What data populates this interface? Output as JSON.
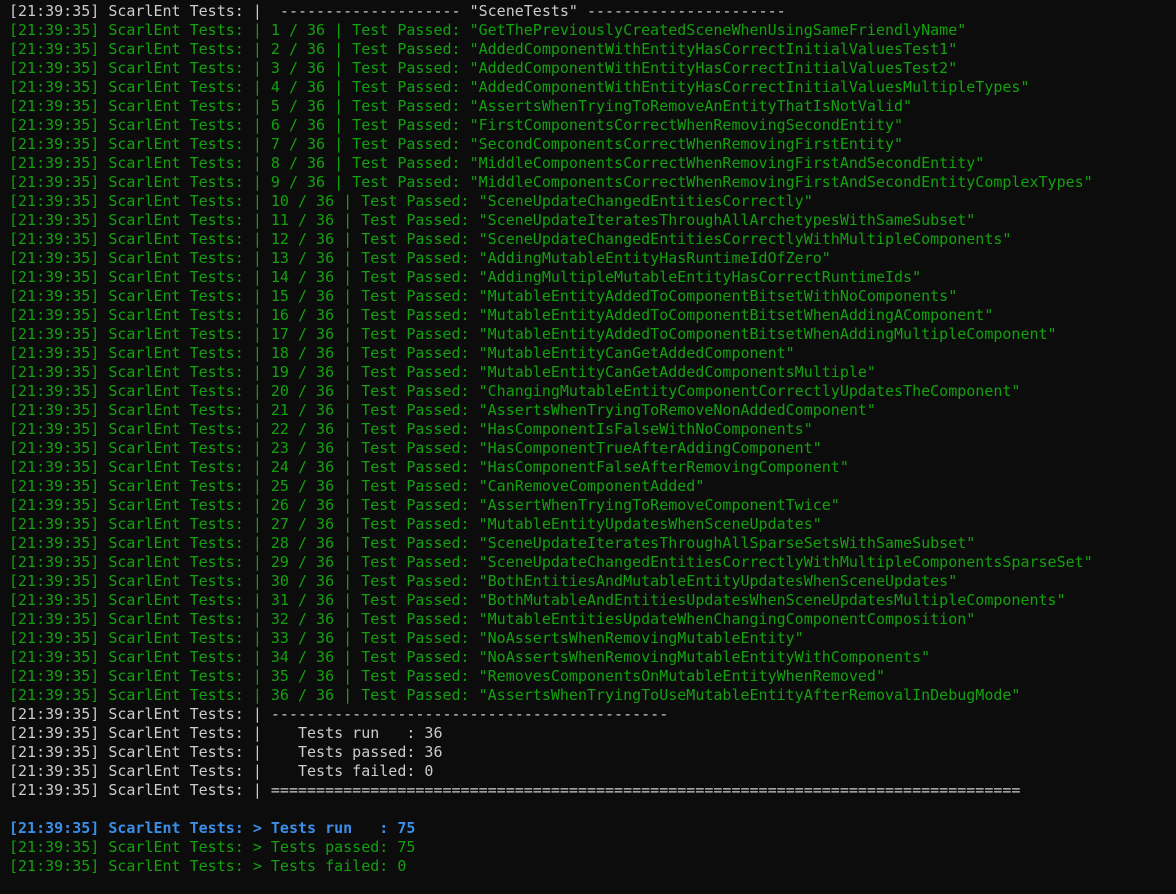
{
  "colors": {
    "background": "#0c0c0c",
    "default_text": "#cccccc",
    "pass_text": "#13a10e",
    "summary_highlight": "#3b8eea"
  },
  "header_line": "[21:39:35] ScarlEnt Tests: |  -------------------- \"SceneTests\" ----------------------",
  "passed_lines": [
    "[21:39:35] ScarlEnt Tests: | 1 / 36 | Test Passed: \"GetThePreviouslyCreatedSceneWhenUsingSameFriendlyName\"",
    "[21:39:35] ScarlEnt Tests: | 2 / 36 | Test Passed: \"AddedComponentWithEntityHasCorrectInitialValuesTest1\"",
    "[21:39:35] ScarlEnt Tests: | 3 / 36 | Test Passed: \"AddedComponentWithEntityHasCorrectInitialValuesTest2\"",
    "[21:39:35] ScarlEnt Tests: | 4 / 36 | Test Passed: \"AddedComponentWithEntityHasCorrectInitialValuesMultipleTypes\"",
    "[21:39:35] ScarlEnt Tests: | 5 / 36 | Test Passed: \"AssertsWhenTryingToRemoveAnEntityThatIsNotValid\"",
    "[21:39:35] ScarlEnt Tests: | 6 / 36 | Test Passed: \"FirstComponentsCorrectWhenRemovingSecondEntity\"",
    "[21:39:35] ScarlEnt Tests: | 7 / 36 | Test Passed: \"SecondComponentsCorrectWhenRemovingFirstEntity\"",
    "[21:39:35] ScarlEnt Tests: | 8 / 36 | Test Passed: \"MiddleComponentsCorrectWhenRemovingFirstAndSecondEntity\"",
    "[21:39:35] ScarlEnt Tests: | 9 / 36 | Test Passed: \"MiddleComponentsCorrectWhenRemovingFirstAndSecondEntityComplexTypes\"",
    "[21:39:35] ScarlEnt Tests: | 10 / 36 | Test Passed: \"SceneUpdateChangedEntitiesCorrectly\"",
    "[21:39:35] ScarlEnt Tests: | 11 / 36 | Test Passed: \"SceneUpdateIteratesThroughAllArchetypesWithSameSubset\"",
    "[21:39:35] ScarlEnt Tests: | 12 / 36 | Test Passed: \"SceneUpdateChangedEntitiesCorrectlyWithMultipleComponents\"",
    "[21:39:35] ScarlEnt Tests: | 13 / 36 | Test Passed: \"AddingMutableEntityHasRuntimeIdOfZero\"",
    "[21:39:35] ScarlEnt Tests: | 14 / 36 | Test Passed: \"AddingMultipleMutableEntityHasCorrectRuntimeIds\"",
    "[21:39:35] ScarlEnt Tests: | 15 / 36 | Test Passed: \"MutableEntityAddedToComponentBitsetWithNoComponents\"",
    "[21:39:35] ScarlEnt Tests: | 16 / 36 | Test Passed: \"MutableEntityAddedToComponentBitsetWhenAddingAComponent\"",
    "[21:39:35] ScarlEnt Tests: | 17 / 36 | Test Passed: \"MutableEntityAddedToComponentBitsetWhenAddingMultipleComponent\"",
    "[21:39:35] ScarlEnt Tests: | 18 / 36 | Test Passed: \"MutableEntityCanGetAddedComponent\"",
    "[21:39:35] ScarlEnt Tests: | 19 / 36 | Test Passed: \"MutableEntityCanGetAddedComponentsMultiple\"",
    "[21:39:35] ScarlEnt Tests: | 20 / 36 | Test Passed: \"ChangingMutableEntityComponentCorrectlyUpdatesTheComponent\"",
    "[21:39:35] ScarlEnt Tests: | 21 / 36 | Test Passed: \"AssertsWhenTryingToRemoveNonAddedComponent\"",
    "[21:39:35] ScarlEnt Tests: | 22 / 36 | Test Passed: \"HasComponentIsFalseWithNoComponents\"",
    "[21:39:35] ScarlEnt Tests: | 23 / 36 | Test Passed: \"HasComponentTrueAfterAddingComponent\"",
    "[21:39:35] ScarlEnt Tests: | 24 / 36 | Test Passed: \"HasComponentFalseAfterRemovingComponent\"",
    "[21:39:35] ScarlEnt Tests: | 25 / 36 | Test Passed: \"CanRemoveComponentAdded\"",
    "[21:39:35] ScarlEnt Tests: | 26 / 36 | Test Passed: \"AssertWhenTryingToRemoveComponentTwice\"",
    "[21:39:35] ScarlEnt Tests: | 27 / 36 | Test Passed: \"MutableEntityUpdatesWhenSceneUpdates\"",
    "[21:39:35] ScarlEnt Tests: | 28 / 36 | Test Passed: \"SceneUpdateIteratesThroughAllSparseSetsWithSameSubset\"",
    "[21:39:35] ScarlEnt Tests: | 29 / 36 | Test Passed: \"SceneUpdateChangedEntitiesCorrectlyWithMultipleComponentsSparseSet\"",
    "[21:39:35] ScarlEnt Tests: | 30 / 36 | Test Passed: \"BothEntitiesAndMutableEntityUpdatesWhenSceneUpdates\"",
    "[21:39:35] ScarlEnt Tests: | 31 / 36 | Test Passed: \"BothMutableAndEntitiesUpdatesWhenSceneUpdatesMultipleComponents\"",
    "[21:39:35] ScarlEnt Tests: | 32 / 36 | Test Passed: \"MutableEntitiesUpdateWhenChangingComponentComposition\"",
    "[21:39:35] ScarlEnt Tests: | 33 / 36 | Test Passed: \"NoAssertsWhenRemovingMutableEntity\"",
    "[21:39:35] ScarlEnt Tests: | 34 / 36 | Test Passed: \"NoAssertsWhenRemovingMutableEntityWithComponents\"",
    "[21:39:35] ScarlEnt Tests: | 35 / 36 | Test Passed: \"RemovesComponentsOnMutableEntityWhenRemoved\"",
    "[21:39:35] ScarlEnt Tests: | 36 / 36 | Test Passed: \"AssertsWhenTryingToUseMutableEntityAfterRemovalInDebugMode\""
  ],
  "suite_summary": {
    "separator": "[21:39:35] ScarlEnt Tests: | --------------------------------------------",
    "run": "[21:39:35] ScarlEnt Tests: |    Tests run   : 36",
    "passed": "[21:39:35] ScarlEnt Tests: |    Tests passed: 36",
    "failed": "[21:39:35] ScarlEnt Tests: |    Tests failed: 0",
    "footer": "[21:39:35] ScarlEnt Tests: | ==================================================================================="
  },
  "total_summary": {
    "run": "[21:39:35] ScarlEnt Tests: > Tests run   : 75",
    "passed": "[21:39:35] ScarlEnt Tests: > Tests passed: 75",
    "failed": "[21:39:35] ScarlEnt Tests: > Tests failed: 0"
  }
}
